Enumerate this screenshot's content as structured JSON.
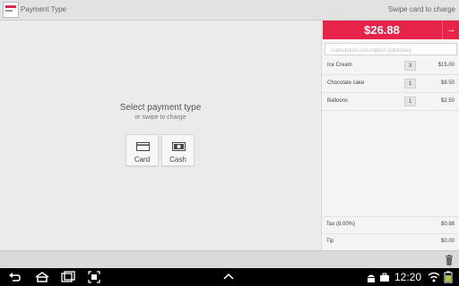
{
  "header": {
    "title": "Payment Type",
    "swipe_hint": "Swipe card to charge"
  },
  "left": {
    "prompt": "Select payment type",
    "sub_prompt": "or swipe to charge",
    "buttons": [
      {
        "label": "Card",
        "icon": "credit-card-icon"
      },
      {
        "label": "Cash",
        "icon": "cash-icon"
      }
    ]
  },
  "right": {
    "total": "$26.88",
    "charge_icon": "arrow-right-icon",
    "description_placeholder": "Transaction Description (Optional)",
    "items": [
      {
        "name": "Ice Cream",
        "qty": "3",
        "price": "$15.00"
      },
      {
        "name": "Chocolate cake",
        "qty": "1",
        "price": "$8.50"
      },
      {
        "name": "Balloons",
        "qty": "1",
        "price": "$2.50"
      }
    ],
    "tax_label": "Tax (8.00%)",
    "tax_value": "$0.88",
    "tip_label": "Tip",
    "tip_value": "$0.00"
  },
  "system": {
    "time": "12:20",
    "icons": [
      "back-icon",
      "home-icon",
      "recent-apps-icon",
      "screenshot-icon",
      "up-chevron-icon",
      "android-icon",
      "briefcase-icon",
      "wifi-icon",
      "battery-icon"
    ]
  },
  "colors": {
    "accent": "#e8234a"
  }
}
